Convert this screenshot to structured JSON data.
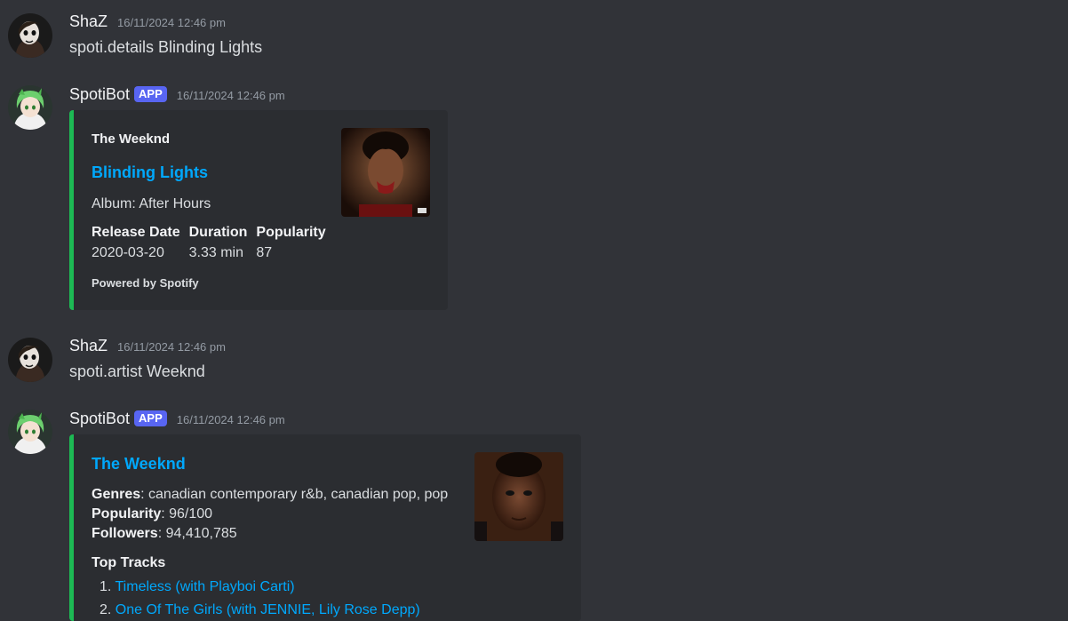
{
  "messages": [
    {
      "username": "ShaZ",
      "timestamp": "16/11/2024 12:46 pm",
      "text": "spoti.details Blinding Lights"
    },
    {
      "username": "SpotiBot",
      "tag": "APP",
      "timestamp": "16/11/2024 12:46 pm",
      "embed": {
        "author": "The Weeknd",
        "title": "Blinding Lights",
        "description": "Album: After Hours",
        "fields": [
          {
            "name": "Release Date",
            "value": "2020-03-20"
          },
          {
            "name": "Duration",
            "value": "3.33 min"
          },
          {
            "name": "Popularity",
            "value": "87"
          }
        ],
        "footer": "Powered by Spotify",
        "thumbnail": "album-cover-after-hours"
      }
    },
    {
      "username": "ShaZ",
      "timestamp": "16/11/2024 12:46 pm",
      "text": "spoti.artist Weeknd"
    },
    {
      "username": "SpotiBot",
      "tag": "APP",
      "timestamp": "16/11/2024 12:46 pm",
      "embed": {
        "title": "The Weeknd",
        "genres_label": "Genres",
        "genres_value": ": canadian contemporary r&b, canadian pop, pop",
        "popularity_label": "Popularity",
        "popularity_value": ": 96/100",
        "followers_label": "Followers",
        "followers_value": ": 94,410,785",
        "top_tracks_title": "Top Tracks",
        "top_tracks": [
          {
            "num": "1.",
            "title": "Timeless (with Playboi Carti)"
          },
          {
            "num": "2.",
            "title": "One Of The Girls (with JENNIE, Lily Rose Depp)"
          }
        ],
        "thumbnail": "artist-photo-the-weeknd"
      }
    }
  ],
  "colors": {
    "background": "#313338",
    "embed_bg": "#2b2d31",
    "embed_accent": "#1db954",
    "link": "#00a8fc",
    "app_tag": "#5865f2"
  }
}
